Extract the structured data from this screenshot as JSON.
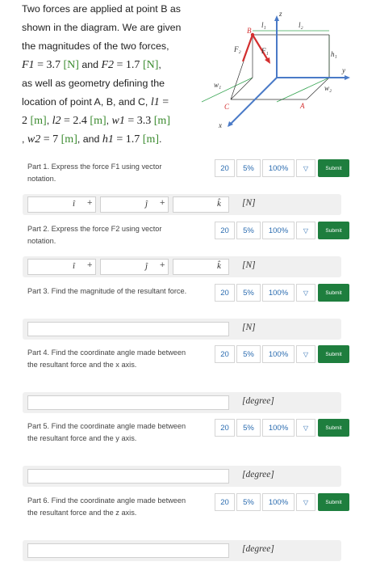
{
  "intro": {
    "line1": "Two forces are applied at point B as",
    "line2": "shown in the diagram. We are given",
    "line3": "the magnitudes of the two forces,",
    "f1_sym": "F1",
    "f1_eq": " = 3.7 ",
    "f1_unit": "[N]",
    "and1": " and ",
    "f2_sym": "F2",
    "f2_eq": " = 1.7 ",
    "f2_unit": "[N]",
    "comma": ",",
    "line5": "as well as geometry defining the",
    "line6": "location of point A, B, and C, ",
    "l1_sym": "l1",
    "eq": " =",
    "l1_val": "2 ",
    "m": "[m]",
    "l2_sym": "l2",
    "l2_eq": " = 2.4 ",
    "w1_sym": "w1",
    "w1_eq": " = 3.3 ",
    "w2_prefix": ", ",
    "w2_sym": "w2",
    "w2_eq": " = 7 ",
    "and2": ", and ",
    "h1_sym": "h1",
    "h1_eq": " = 1.7 ",
    "period": "."
  },
  "diagram": {
    "labels": {
      "z": "z",
      "y": "y",
      "x": "x",
      "l1": "l₁",
      "l2": "l₂",
      "h1": "h₁",
      "w1": "w₁",
      "w2": "w₂",
      "A": "A",
      "B": "B",
      "C": "C",
      "F1": "F₁",
      "F2": "F₂"
    },
    "colors": {
      "axis": "#4a7ac7",
      "force": "#d32f2f",
      "dim": "#3aa655",
      "point": "#d32f2f"
    }
  },
  "controls": {
    "c20": "20",
    "c5": "5%",
    "c100": "100%",
    "dropdown": "▽",
    "submit": "Submit"
  },
  "parts": [
    {
      "text": "Part 1. Express the force F1 using vector notation.",
      "unit": "[N]"
    },
    {
      "text": "Part 2. Express the force F2 using vector notation.",
      "unit": "[N]"
    },
    {
      "text": "Part 3. Find the magnitude of the resultant force.",
      "unit": "[N]"
    },
    {
      "text": "Part 4. Find the coordinate angle made between the resultant force and the x axis.",
      "unit": "[degree]"
    },
    {
      "text": "Part 5. Find the coordinate angle made between the resultant force and the y axis.",
      "unit": "[degree]"
    },
    {
      "text": "Part 6. Find the coordinate angle made between the resultant force and the z axis.",
      "unit": "[degree]"
    }
  ],
  "vector": {
    "i": "î",
    "j": "ĵ",
    "k": "k̂",
    "plus": "+"
  }
}
